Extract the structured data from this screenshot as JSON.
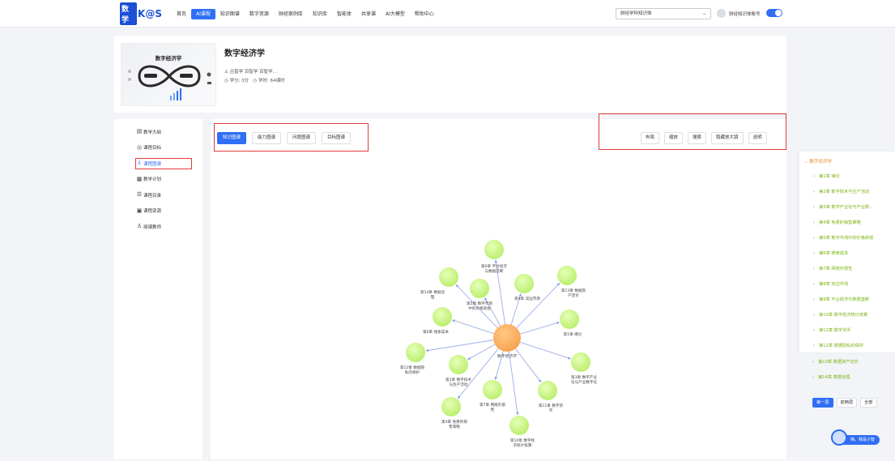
{
  "brand": {
    "logo_main": "数学",
    "logo_sub": "K@S"
  },
  "nav": {
    "items": [
      "首页",
      "AI课程",
      "知识图谱",
      "数字资源",
      "财经案例库",
      "知识库",
      "智能体",
      "共享课",
      "AI大模型",
      "帮助中心"
    ],
    "active_index": 1
  },
  "header_right": {
    "select_value": "财经学科知识体",
    "user_name": "财经知识体账号"
  },
  "course": {
    "thumb_title": "数字经济学",
    "title": "数字经济学",
    "teachers": "吕智学 百智学 百智学...",
    "credits": "学分: 3分",
    "hours": "学时: 64课时"
  },
  "sidebar": {
    "items": [
      {
        "label": "教学大纲",
        "icon": "syllabus-icon"
      },
      {
        "label": "课程目标",
        "icon": "target-icon"
      },
      {
        "label": "课程图谱",
        "icon": "graph-icon"
      },
      {
        "label": "教学计划",
        "icon": "plan-icon"
      },
      {
        "label": "课程目录",
        "icon": "list-icon"
      },
      {
        "label": "课程资源",
        "icon": "resource-icon"
      },
      {
        "label": "授课教师",
        "icon": "teacher-icon"
      }
    ],
    "active_index": 2
  },
  "graph_tabs": {
    "items": [
      "知识图谱",
      "能力图谱",
      "问题图谱",
      "目标图谱"
    ],
    "active_index": 0
  },
  "graph_tools": [
    "布局",
    "缩放",
    "搜索",
    "隐藏放大镜",
    "说明"
  ],
  "graph": {
    "center": "数字经济学",
    "nodes": [
      "第6章 平台经济与数据垄断",
      "第14章 数据治理",
      "第5章 数字市场中的价格歧视",
      "第9章 双边市场",
      "第13章 数据资产定价",
      "第6章 搜索成本",
      "第1章 绪论",
      "第12章 数据隐私的保护",
      "第2章 数字技术与生产活动",
      "第3章 数字产业化与产业数字化",
      "第7章 网络外部性",
      "第11章 数字货币",
      "第4章 免费的销售策略",
      "第10章 数字经济统计核算"
    ]
  },
  "chapters": {
    "root": "数字经济学",
    "items": [
      "第1章 绪论",
      "第2章 数字技术与生产活动",
      "第3章 数字产业化与产业数...",
      "第4章 免费的销售策略",
      "第5章 数字市场中的价格歧视",
      "第6章 搜索成本",
      "第7章 网络外部性",
      "第8章 双边市场",
      "第9章 平台经济与数据垄断",
      "第10章 数字经济统计核算",
      "第11章 数字货币",
      "第12章 数据隐私的保护",
      "第13章 数据资产定价",
      "第14章 数据治理"
    ]
  },
  "levels": {
    "items": [
      "第一层",
      "前两层",
      "全部"
    ],
    "active_index": 0
  },
  "assistant": {
    "label": "嗨，我是小智"
  },
  "colors": {
    "accent": "#2f6ef5",
    "node_green": "#b8ee6a",
    "center_orange": "#f7a04e",
    "highlight_red": "#e23b3b",
    "chapter_green": "#7cb518"
  }
}
